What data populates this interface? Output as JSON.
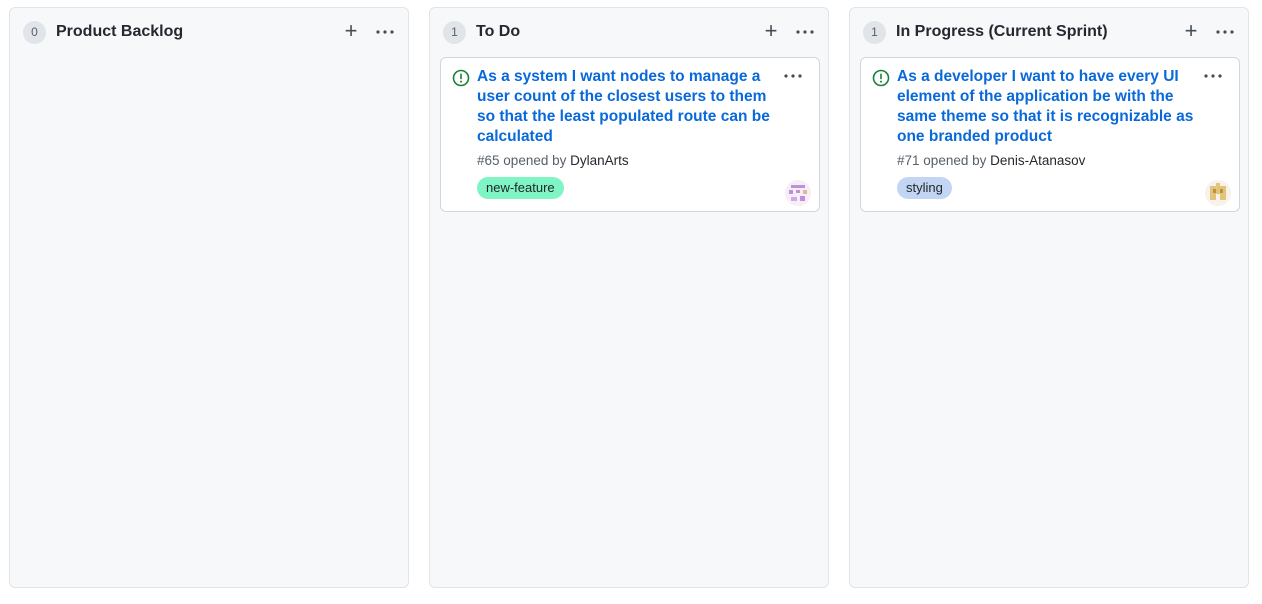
{
  "columns": [
    {
      "count": "0",
      "title": "Product Backlog",
      "add_icon": "plus-icon",
      "more_icon": "kebab-horizontal-icon"
    },
    {
      "count": "1",
      "title": "To Do",
      "add_icon": "plus-icon",
      "more_icon": "kebab-horizontal-icon",
      "card": {
        "status_icon": "issue-opened-icon",
        "title": "As a system I want nodes to manage a user count of the closest users to them so that the least populated route can be calculated",
        "number": "#65",
        "opened_by_text": "opened by",
        "author": "DylanArts",
        "label": "new-feature",
        "label_color": "#7ff5c5"
      }
    },
    {
      "count": "1",
      "title": "In Progress (Current Sprint)",
      "add_icon": "plus-icon",
      "more_icon": "kebab-horizontal-icon",
      "card": {
        "status_icon": "issue-opened-icon",
        "title": "As a developer I want to have every UI element of the application be with the same theme so that it is recognizable as one branded product",
        "number": "#71",
        "opened_by_text": "opened by",
        "author": "Denis-Atanasov",
        "label": "styling",
        "label_color": "#c2d6f4"
      }
    }
  ],
  "colors": {
    "column_bg": "#f6f8fa",
    "link": "#0969da",
    "issue_open": "#1a7f37"
  }
}
